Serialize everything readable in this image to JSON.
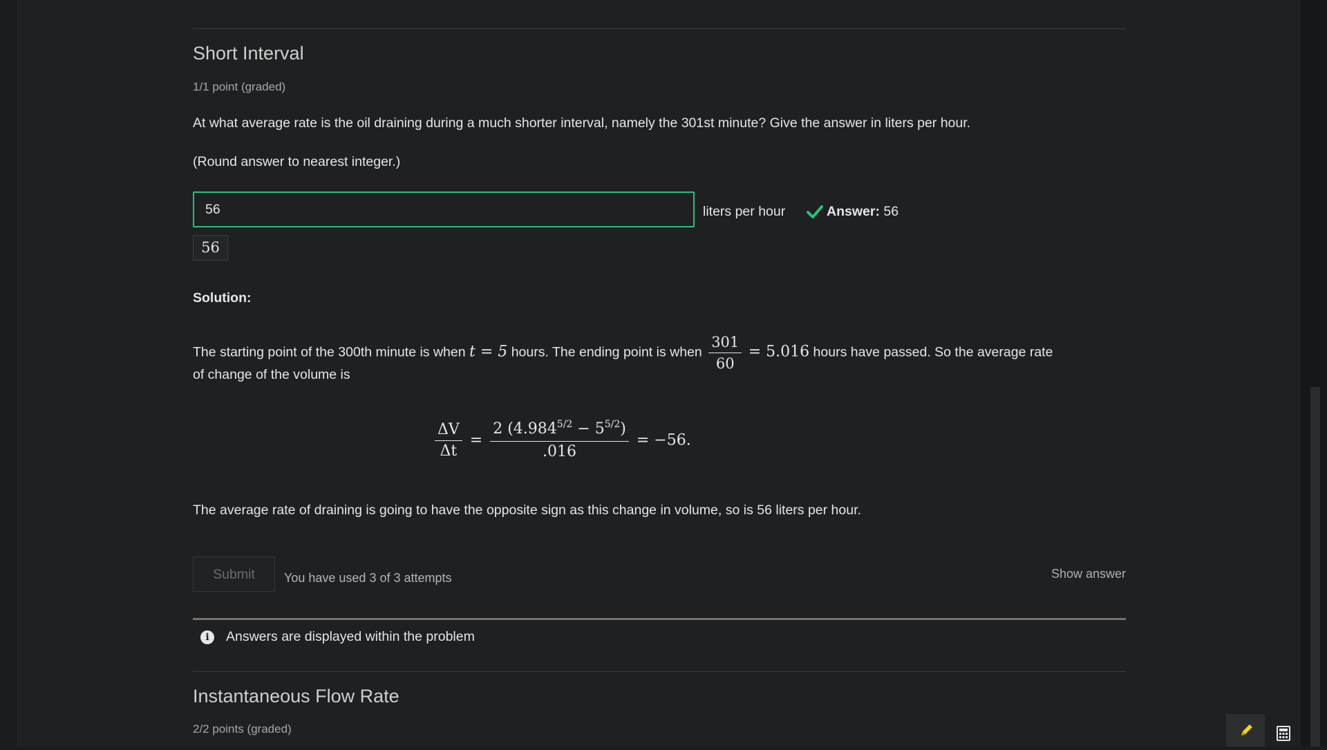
{
  "section1": {
    "title": "Short Interval",
    "points": "1/1 point (graded)",
    "question": "At what average rate is the oil draining during a much shorter interval, namely the 301st minute? Give the answer in liters per hour.",
    "instruction": "(Round answer to nearest integer.)",
    "input_value": "56",
    "unit": "liters per hour",
    "answer_label": "Answer:",
    "answer_value": "56",
    "preview_value": "56",
    "status_color": "#2ac17a"
  },
  "solution": {
    "heading": "Solution:",
    "p1_a": "The starting point of the 300th minute is when",
    "p1_t": "t = 5",
    "p1_b": "hours. The ending point is when",
    "frac_num": "301",
    "frac_den": "60",
    "p1_eq": "= 5.016",
    "p1_c": "hours have passed. So the average rate",
    "p1_d": "of change of the volume is",
    "eq": {
      "lhs_num": "ΔV",
      "lhs_den": "Δt",
      "rhs_num_a": "2 (4.984",
      "rhs_exp1": "5/2",
      "rhs_num_b": " − 5",
      "rhs_exp2": "5/2",
      "rhs_num_c": ")",
      "rhs_den": ".016",
      "result": "= −56."
    },
    "conclusion": "The average rate of draining is going to have the opposite sign as this change in volume, so is 56 liters per hour."
  },
  "actions": {
    "submit_label": "Submit",
    "attempts_text": "You have used 3 of 3 attempts",
    "show_answer_label": "Show answer"
  },
  "notice": {
    "text": "Answers are displayed within the problem",
    "icon": "info-icon"
  },
  "section2": {
    "title": "Instantaneous Flow Rate",
    "points": "2/2 points (graded)"
  },
  "tools": {
    "pencil_icon": "pencil-icon",
    "calculator_icon": "calculator-icon",
    "pencil_color": "#f2d21b"
  }
}
